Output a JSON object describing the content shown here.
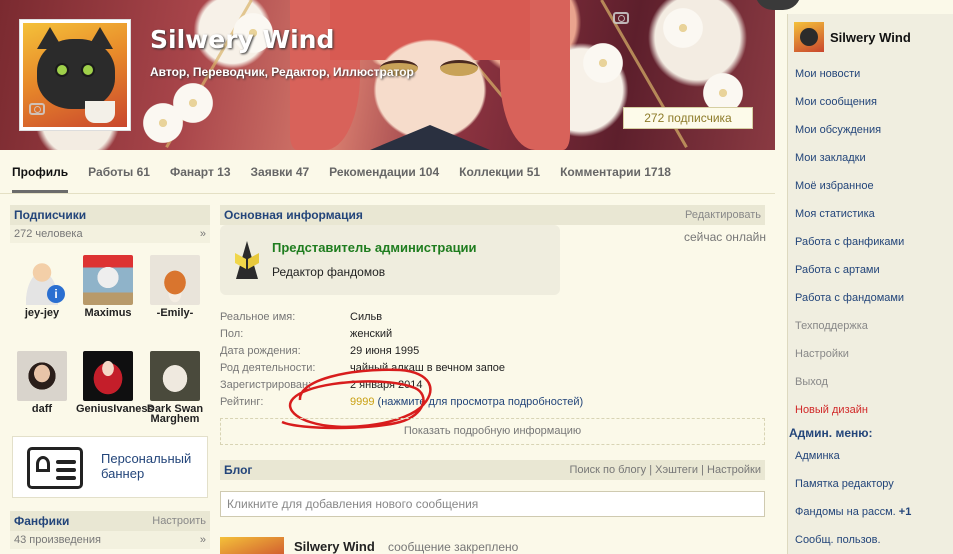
{
  "profile": {
    "name": "Silwery Wind",
    "roles": "Автор, Переводчик, Редактор, Иллюстратор",
    "subscribers_badge": "272 подписчика"
  },
  "tabs": [
    {
      "label": "Профиль",
      "active": true
    },
    {
      "label": "Работы 61"
    },
    {
      "label": "Фанарт 13"
    },
    {
      "label": "Заявки 47"
    },
    {
      "label": "Рекомендации 104"
    },
    {
      "label": "Коллекции 51"
    },
    {
      "label": "Комментарии 1718"
    }
  ],
  "subscribers": {
    "title": "Подписчики",
    "count": "272 человека",
    "arrow": "»",
    "items": [
      {
        "name": "jey-jey",
        "icon": "default-user-avatar"
      },
      {
        "name": "Maximus",
        "icon": "cat-avatar"
      },
      {
        "name": "-Emily-",
        "icon": "fox-avatar"
      },
      {
        "name": "daff",
        "icon": "girl-avatar"
      },
      {
        "name": "GeniusIvaness",
        "icon": "anime-girl-avatar"
      },
      {
        "name": "Dark Swan Marghem",
        "icon": "owl-avatar"
      }
    ]
  },
  "personal_banner": "Персональный баннер",
  "fanfics": {
    "title": "Фанфики",
    "action": "Настроить",
    "count": "43 произведения",
    "arrow": "»"
  },
  "main_info": {
    "title": "Основная информация",
    "edit": "Редактировать",
    "admin_title": "Представитель администрации",
    "admin_sub": "Редактор фандомов",
    "online": "сейчас онлайн",
    "rows": [
      {
        "k": "Реальное имя:",
        "v": "Сильв"
      },
      {
        "k": "Пол:",
        "v": "женский"
      },
      {
        "k": "Дата рождения:",
        "v": "29 июня 1995"
      },
      {
        "k": "Род деятельности:",
        "v": "чайный алкаш в вечном запое"
      },
      {
        "k": "Зарегистрирован:",
        "v": "2 января 2014"
      }
    ],
    "rating_label": "Рейтинг:",
    "rating_value": "9999",
    "rating_hint": "(нажмите для просмотра подробностей)",
    "more": "Показать подробную информацию"
  },
  "blog": {
    "title": "Блог",
    "links": "Поиск по блогу | Хэштеги | Настройки",
    "placeholder": "Кликните для добавления нового сообщения",
    "post_author": "Silwery Wind",
    "post_status": "сообщение закреплено"
  },
  "sidebar": {
    "user": "Silwery Wind",
    "items": [
      {
        "label": "Мои новости"
      },
      {
        "label": "Мои сообщения"
      },
      {
        "label": "Мои обсуждения"
      },
      {
        "label": "Мои закладки"
      },
      {
        "label": "Моё избранное"
      },
      {
        "label": "Моя статистика"
      },
      {
        "label": "Работа с фанфиками"
      },
      {
        "label": "Работа с артами"
      },
      {
        "label": "Работа с фандомами"
      },
      {
        "label": "Техподдержка",
        "style": "grey"
      },
      {
        "label": "Настройки",
        "style": "grey"
      },
      {
        "label": "Выход",
        "style": "grey"
      },
      {
        "label": "Новый дизайн",
        "style": "red"
      }
    ],
    "admin_menu": "Админ. меню:",
    "admin_items": [
      {
        "label": "Админка"
      },
      {
        "label": "Памятка редактору"
      },
      {
        "label": "Фандомы на рассм.",
        "badge": "+1"
      },
      {
        "label": "Сообщ. пользов."
      }
    ]
  },
  "colors": {
    "link": "#23457a",
    "accent_green": "#1f7d1f",
    "rating_gold": "#c9a013",
    "annotation_red": "#d81d1d"
  }
}
